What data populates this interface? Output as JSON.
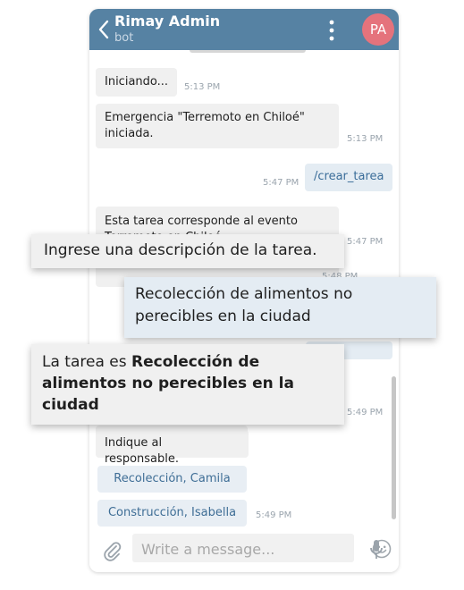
{
  "header": {
    "title": "Rimay Admin",
    "subtitle": "bot",
    "avatar_initials": "PA",
    "color": "#5682a3",
    "avatar_color": "#e5737c"
  },
  "messages": [
    {
      "text": "Iniciando...",
      "time": "5:13 PM",
      "direction": "in"
    },
    {
      "text": "Emergencia \"Terremoto en Chiloé\" iniciada.",
      "time": "5:13 PM",
      "direction": "in"
    },
    {
      "text": "/crear_tarea",
      "time": "5:47 PM",
      "direction": "out"
    },
    {
      "text": "Esta tarea corresponde al evento Terremoto en Chiloé",
      "time": "5:47 PM",
      "direction": "in"
    },
    {
      "time_partial": "5:48 PM"
    },
    {
      "time": "5:49 PM"
    },
    {
      "text": "Indique al responsable.",
      "direction": "in"
    }
  ],
  "reply_buttons": [
    {
      "label": "Recolección, Camila"
    },
    {
      "label": "Construcción, Isabella",
      "time": "5:49 PM"
    }
  ],
  "overlays": {
    "prompt": "Ingrese una descripción de la tarea.",
    "answer": "Recolección de alimentos no perecibles en la ciudad",
    "confirm_prefix": "La tarea es ",
    "confirm_bold": "Recolección de alimentos no perecibles en la ciudad"
  },
  "composer": {
    "placeholder": "Write a message..."
  },
  "icons": [
    "back-arrow-icon",
    "more-vertical-icon",
    "paperclip-icon",
    "emoji-icon",
    "microphone-icon"
  ]
}
